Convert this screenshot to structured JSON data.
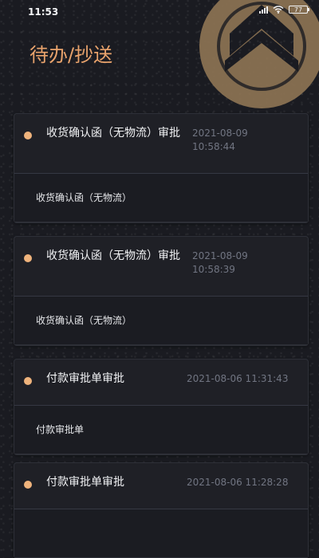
{
  "status_bar": {
    "time": "11:53",
    "battery": "77",
    "icons": [
      "signal-icon",
      "wifi-icon",
      "battery-icon"
    ]
  },
  "header": {
    "title": "待办/抄送",
    "title_color": "#e9a36c",
    "logo_icon": "brand-logo"
  },
  "colors": {
    "background": "#1a1b21",
    "card_background": "#1f2026",
    "accent": "#efb37c",
    "timestamp": "#717582"
  },
  "tasks": [
    {
      "title": "收货确认函（无物流）审批",
      "time": "2021-08-09\n10:58:44",
      "content": "收货确认函（无物流）"
    },
    {
      "title": "收货确认函（无物流）审批",
      "time": "2021-08-09\n10:58:39",
      "content": "收货确认函（无物流）"
    },
    {
      "title": "付款审批单审批",
      "time": "2021-08-06 11:31:43",
      "content": "付款审批单"
    },
    {
      "title": "付款审批单审批",
      "time": "2021-08-06 11:28:28",
      "content": ""
    }
  ]
}
